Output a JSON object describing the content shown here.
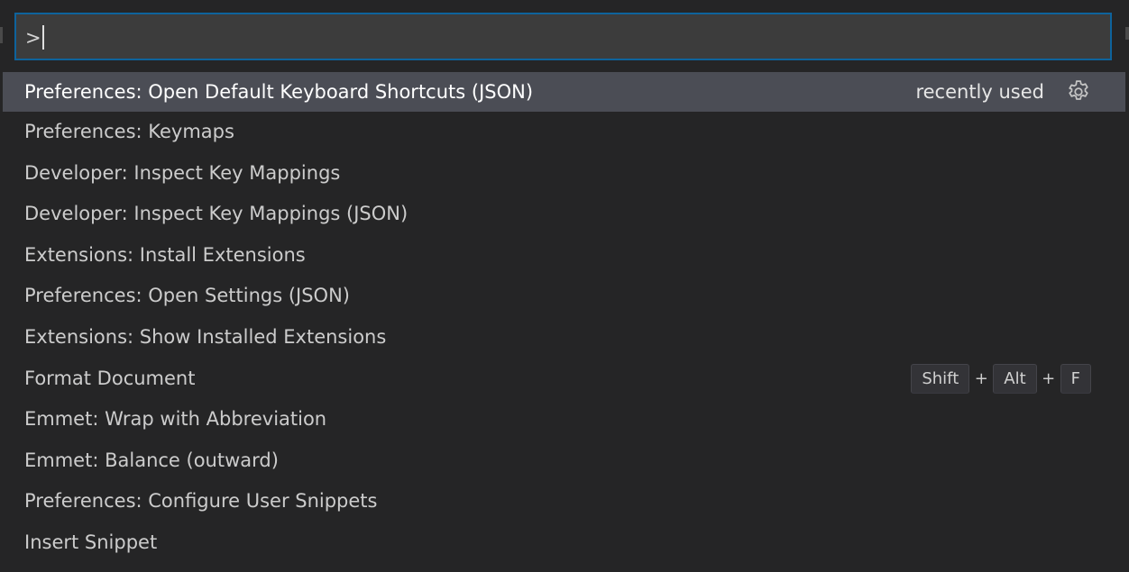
{
  "quick_input": {
    "value": ">"
  },
  "commands": [
    {
      "label": "Preferences: Open Default Keyboard Shortcuts (JSON)",
      "selected": true,
      "badge": "recently used",
      "icon": "gear-icon"
    },
    {
      "label": "Preferences: Keymaps"
    },
    {
      "label": "Developer: Inspect Key Mappings"
    },
    {
      "label": "Developer: Inspect Key Mappings (JSON)"
    },
    {
      "label": "Extensions: Install Extensions"
    },
    {
      "label": "Preferences: Open Settings (JSON)"
    },
    {
      "label": "Extensions: Show Installed Extensions"
    },
    {
      "label": "Format Document",
      "keybinding": {
        "keys": [
          "Shift",
          "Alt",
          "F"
        ],
        "separator": "+"
      }
    },
    {
      "label": "Emmet: Wrap with Abbreviation"
    },
    {
      "label": "Emmet: Balance (outward)"
    },
    {
      "label": "Preferences: Configure User Snippets"
    },
    {
      "label": "Insert Snippet"
    }
  ],
  "colors": {
    "background": "#252526",
    "input_background": "#3c3c3c",
    "focus_border": "#0e639c",
    "selection_background": "#4b4d55",
    "text": "#cccccc"
  }
}
